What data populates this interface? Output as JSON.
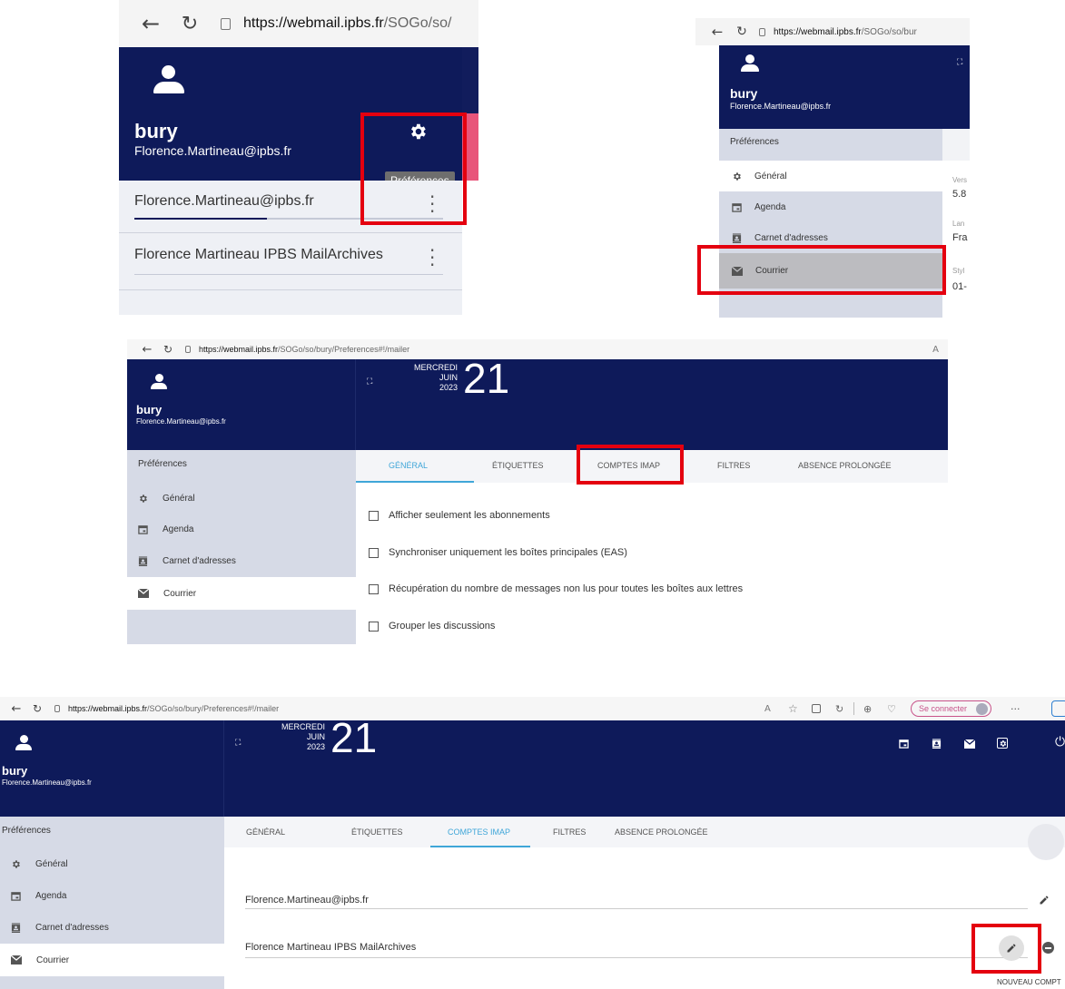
{
  "colors": {
    "navy": "#0e1a5a",
    "sidebar": "#d6dae6",
    "accent": "#3fa6d8",
    "highlight": "#e4000f",
    "pink": "#e8557a"
  },
  "panel1": {
    "url": {
      "host": "https://webmail.ipbs.fr",
      "rest": "/SOGo/so/"
    },
    "user": {
      "name": "bury",
      "email": "Florence.Martineau@ipbs.fr"
    },
    "tooltip": "Préférences",
    "accounts": [
      {
        "label": "Florence.Martineau@ipbs.fr"
      },
      {
        "label": "Florence Martineau IPBS MailArchives"
      }
    ]
  },
  "panel2": {
    "url": {
      "host": "https://webmail.ipbs.fr",
      "rest": "/SOGo/so/bur"
    },
    "user": {
      "name": "bury",
      "email": "Florence.Martineau@ipbs.fr"
    },
    "sidebar_title": "Préférences",
    "items": [
      {
        "label": "Général",
        "icon": "gear-icon"
      },
      {
        "label": "Agenda",
        "icon": "calendar-icon"
      },
      {
        "label": "Carnet d'adresses",
        "icon": "contacts-icon"
      },
      {
        "label": "Courrier",
        "icon": "mail-icon"
      }
    ],
    "right_frag": {
      "l1": "Vers",
      "v1": "5.8",
      "l2": "Lan",
      "v2": "Fra",
      "l3": "Styl",
      "v3": "01-"
    }
  },
  "panel3": {
    "url": {
      "host": "https://webmail.ipbs.fr",
      "rest": "/SOGo/so/bury/Preferences#!/mailer"
    },
    "reader_mode": "A",
    "user": {
      "name": "bury",
      "email": "Florence.Martineau@ipbs.fr"
    },
    "date": {
      "weekday": "MERCREDI",
      "month": "JUIN",
      "year": "2023",
      "day": "21"
    },
    "sidebar_title": "Préférences",
    "items": [
      {
        "label": "Général"
      },
      {
        "label": "Agenda"
      },
      {
        "label": "Carnet d'adresses"
      },
      {
        "label": "Courrier"
      }
    ],
    "tabs": [
      "GÉNÉRAL",
      "ÉTIQUETTES",
      "COMPTES IMAP",
      "FILTRES",
      "ABSENCE PROLONGÉE"
    ],
    "options": [
      "Afficher seulement les abonnements",
      "Synchroniser uniquement les boîtes principales (EAS)",
      "Récupération du nombre de messages non lus pour toutes les boîtes aux lettres",
      "Grouper les discussions"
    ]
  },
  "panel4": {
    "url": {
      "host": "https://webmail.ipbs.fr",
      "rest": "/SOGo/so/bury/Preferences#!/mailer"
    },
    "connect_label": "Se connecter",
    "more": "···",
    "user": {
      "name": "bury",
      "email": "Florence.Martineau@ipbs.fr"
    },
    "date": {
      "weekday": "MERCREDI",
      "month": "JUIN",
      "year": "2023",
      "day": "21"
    },
    "sidebar_title": "Préférences",
    "items": [
      {
        "label": "Général"
      },
      {
        "label": "Agenda"
      },
      {
        "label": "Carnet d'adresses"
      },
      {
        "label": "Courrier"
      }
    ],
    "tabs": [
      "GÉNÉRAL",
      "ÉTIQUETTES",
      "COMPTES IMAP",
      "FILTRES",
      "ABSENCE PROLONGÉE"
    ],
    "accounts": [
      {
        "label": "Florence.Martineau@ipbs.fr"
      },
      {
        "label": "Florence Martineau IPBS MailArchives"
      }
    ],
    "new_account": "NOUVEAU COMPT"
  }
}
